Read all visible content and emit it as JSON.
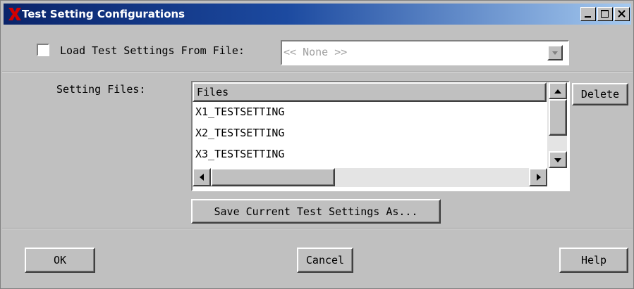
{
  "window": {
    "title": "Test Setting Configurations",
    "controls": [
      "minimize-icon",
      "maximize-icon",
      "close-icon"
    ]
  },
  "load": {
    "checkbox_checked": false,
    "label": "Load Test Settings From File:",
    "dropdown_value": "<< None >>"
  },
  "files": {
    "label": "Setting Files:",
    "column_header": "Files",
    "items": [
      "X1_TESTSETTING",
      "X2_TESTSETTING",
      "X3_TESTSETTING"
    ],
    "delete_label": "Delete",
    "save_as_label": "Save Current Test Settings As..."
  },
  "footer": {
    "ok_label": "OK",
    "cancel_label": "Cancel",
    "help_label": "Help"
  },
  "colors": {
    "titlebar_start": "#0a246a",
    "titlebar_end": "#a6caf0",
    "logo": "#d40000",
    "face": "#c0c0c0"
  }
}
